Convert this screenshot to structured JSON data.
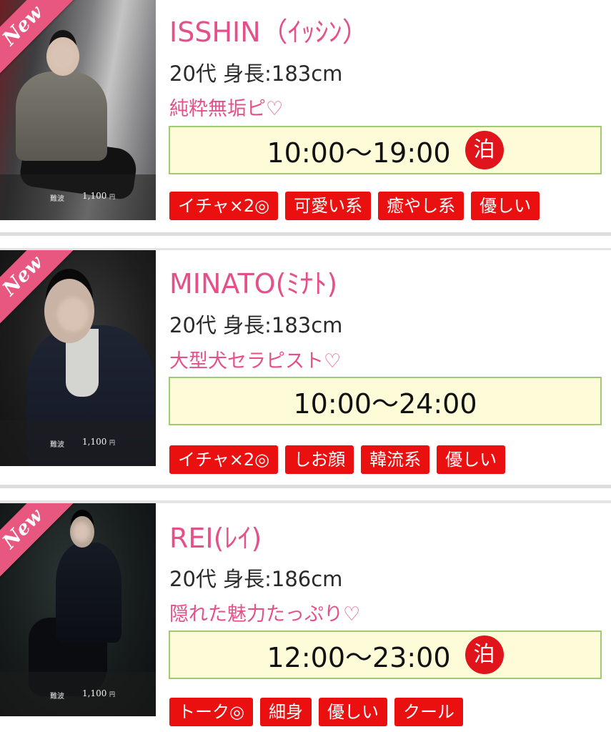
{
  "therapists": [
    {
      "badge": "New",
      "name": "ISSHIN（ｲｯｼﾝ）",
      "stats": "20代 身長:183cm",
      "catchphrase": "純粋無垢ピ♡",
      "hours": "10:00〜19:00",
      "stay": "泊",
      "photo_area": "難波",
      "photo_price": "1,100",
      "photo_unit": "円",
      "tags": [
        "イチャ×2◎",
        "可愛い系",
        "癒やし系",
        "優しい"
      ]
    },
    {
      "badge": "New",
      "name": "MINATO(ﾐﾅﾄ)",
      "stats": "20代 身長:183cm",
      "catchphrase": "大型犬セラピスト♡",
      "hours": "10:00〜24:00",
      "stay": "",
      "photo_area": "難波",
      "photo_price": "1,100",
      "photo_unit": "円",
      "tags": [
        "イチャ×2◎",
        "しお顔",
        "韓流系",
        "優しい"
      ]
    },
    {
      "badge": "New",
      "name": "REI(ﾚｲ)",
      "stats": "20代 身長:186cm",
      "catchphrase": "隠れた魅力たっぷり♡",
      "hours": "12:00〜23:00",
      "stay": "泊",
      "photo_area": "難波",
      "photo_price": "1,100",
      "photo_unit": "円",
      "tags": [
        "トーク◎",
        "細身",
        "優しい",
        "クール"
      ]
    }
  ],
  "colors": {
    "name_pink": "#e4518a",
    "ribbon_pink": "#e8577f",
    "tag_red": "#ea1010",
    "stay_red": "#e0151c",
    "hours_bg": "#fefcd8",
    "hours_border": "#9fcc72"
  }
}
